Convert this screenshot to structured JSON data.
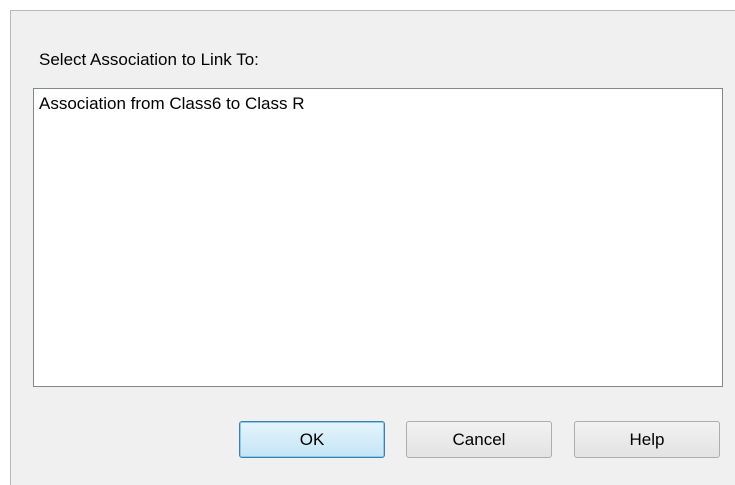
{
  "dialog": {
    "prompt": "Select Association to Link To:",
    "list_items": [
      "Association from Class6 to Class R"
    ],
    "buttons": {
      "ok": "OK",
      "cancel": "Cancel",
      "help": "Help"
    }
  },
  "colors": {
    "default_button_border": "#3c7fb1",
    "default_button_fill": "#c4e5f6",
    "dialog_background": "#f0f0f0",
    "listbox_border": "#828790"
  }
}
